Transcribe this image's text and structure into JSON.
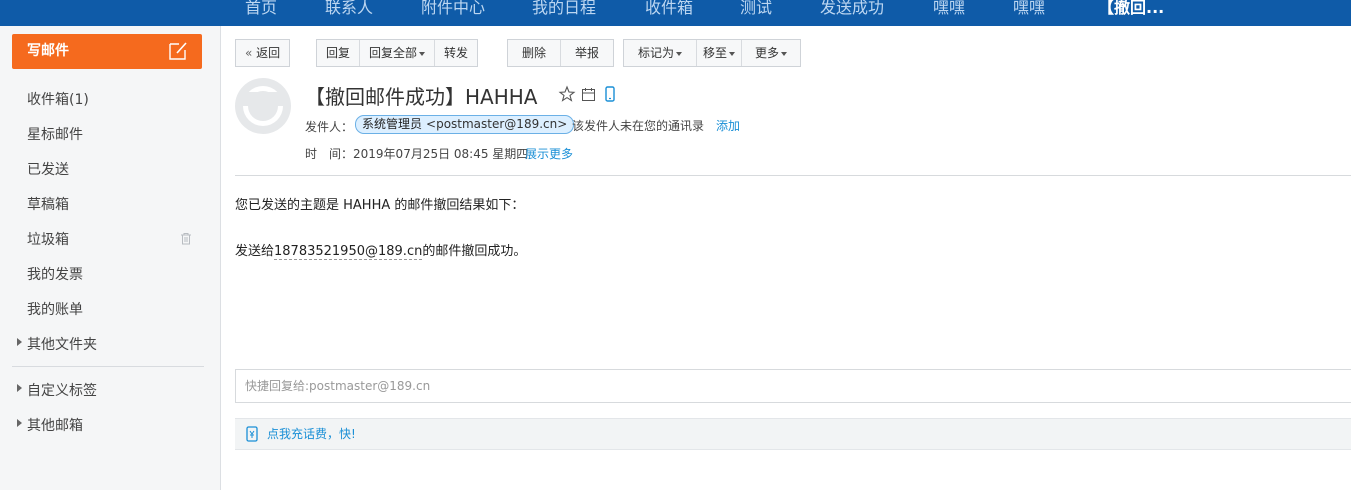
{
  "nav": {
    "tabs": [
      {
        "label": "首页"
      },
      {
        "label": "联系人"
      },
      {
        "label": "附件中心"
      },
      {
        "label": "我的日程"
      },
      {
        "label": "收件箱"
      },
      {
        "label": "测试"
      },
      {
        "label": "发送成功"
      },
      {
        "label": "嘿嘿"
      },
      {
        "label": "嘿嘿"
      },
      {
        "label": "【撤回..."
      }
    ]
  },
  "sidebar": {
    "compose_label": "写邮件",
    "folders": [
      {
        "label": "收件箱(1)"
      },
      {
        "label": "星标邮件"
      },
      {
        "label": "已发送"
      },
      {
        "label": "草稿箱"
      },
      {
        "label": "垃圾箱"
      },
      {
        "label": "我的发票"
      },
      {
        "label": "我的账单"
      },
      {
        "label": "其他文件夹"
      }
    ],
    "groups": [
      {
        "label": "自定义标签"
      },
      {
        "label": "其他邮箱"
      }
    ]
  },
  "toolbar": {
    "back": "返回",
    "reply": "回复",
    "reply_all": "回复全部",
    "forward": "转发",
    "delete": "删除",
    "report": "举报",
    "mark_as": "标记为",
    "move_to": "移至",
    "more": "更多"
  },
  "mail": {
    "subject": "【撤回邮件成功】HAHHA",
    "from_label": "发件人：",
    "sender_name": "系统管理员",
    "sender_email": "<postmaster@189.cn>",
    "not_in_contacts": "该发件人未在您的通讯录",
    "add_link": "添加",
    "time_label": "时　间：",
    "time_value": "2019年07月25日 08:45 星期四",
    "show_more": "展示更多",
    "body_line1": "您已发送的主题是 HAHHA 的邮件撤回结果如下：",
    "body_prefix": "发送给",
    "body_email": "18783521950@189.cn",
    "body_suffix": "的邮件撤回成功。"
  },
  "quick_reply": {
    "placeholder": "快捷回复给:postmaster@189.cn"
  },
  "promo": {
    "text": "点我充话费，快!"
  },
  "colors": {
    "nav_bg": "#0f5ba8",
    "compose_bg": "#f56a1e",
    "link": "#1a8fd6",
    "sender_pill_bg": "#dcefff"
  }
}
